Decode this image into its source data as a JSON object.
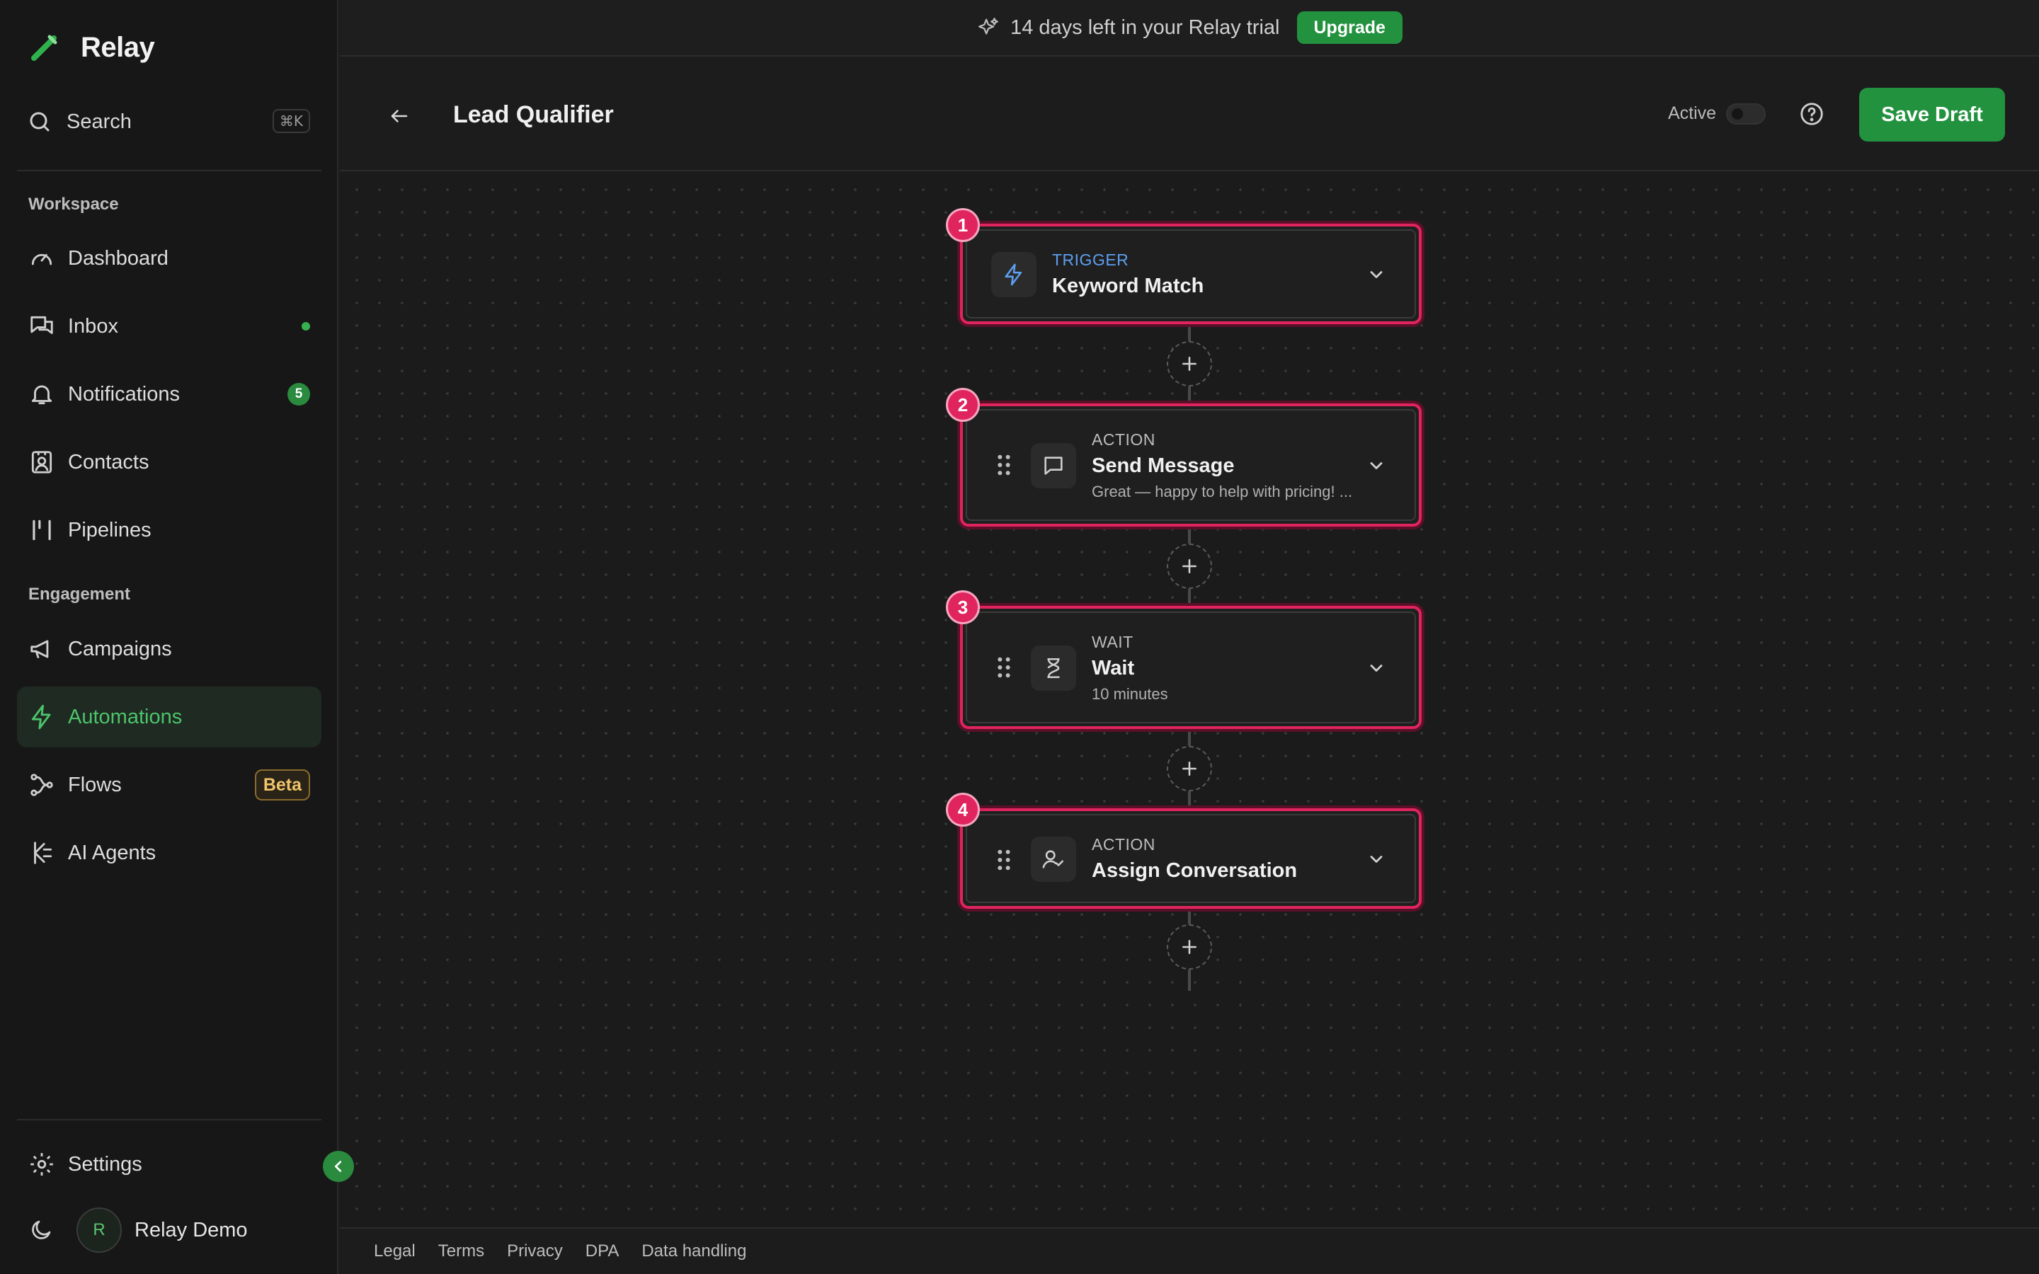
{
  "app": {
    "name": "Relay"
  },
  "sidebar": {
    "search_label": "Search",
    "search_shortcut": "⌘K",
    "sections": [
      {
        "label": "Workspace"
      },
      {
        "label": "Engagement"
      }
    ],
    "items": [
      {
        "label": "Dashboard",
        "icon": "gauge-icon"
      },
      {
        "label": "Inbox",
        "icon": "inbox-icon",
        "indicator": "dot"
      },
      {
        "label": "Notifications",
        "icon": "bell-icon",
        "count": "5"
      },
      {
        "label": "Contacts",
        "icon": "contact-icon"
      },
      {
        "label": "Pipelines",
        "icon": "pipeline-icon"
      },
      {
        "label": "Campaigns",
        "icon": "megaphone-icon"
      },
      {
        "label": "Automations",
        "icon": "bolt-icon",
        "active": true
      },
      {
        "label": "Flows",
        "icon": "flow-icon",
        "badge": "Beta"
      },
      {
        "label": "AI Agents",
        "icon": "agent-icon"
      }
    ],
    "settings_label": "Settings",
    "user": {
      "initial": "R",
      "name": "Relay Demo"
    }
  },
  "banner": {
    "text": "14 days left in your Relay trial",
    "upgrade_label": "Upgrade"
  },
  "header": {
    "title": "Lead Qualifier",
    "active_label": "Active",
    "active_state": false,
    "save_label": "Save Draft"
  },
  "workflow": {
    "steps": [
      {
        "number": "1",
        "type": "TRIGGER",
        "title": "Keyword Match",
        "subtitle": "",
        "icon": "bolt-icon"
      },
      {
        "number": "2",
        "type": "ACTION",
        "title": "Send Message",
        "subtitle": "Great — happy to help with pricing! ...",
        "icon": "message-icon"
      },
      {
        "number": "3",
        "type": "WAIT",
        "title": "Wait",
        "subtitle": "10 minutes",
        "icon": "hourglass-icon"
      },
      {
        "number": "4",
        "type": "ACTION",
        "title": "Assign Conversation",
        "subtitle": "",
        "icon": "user-check-icon"
      }
    ]
  },
  "footer": {
    "links": [
      "Legal",
      "Terms",
      "Privacy",
      "DPA",
      "Data handling"
    ]
  },
  "colors": {
    "accent_green": "#23923f",
    "node_border": "#e0245e",
    "trigger_blue": "#5d9ff0",
    "beta_gold": "#f1c56a"
  }
}
